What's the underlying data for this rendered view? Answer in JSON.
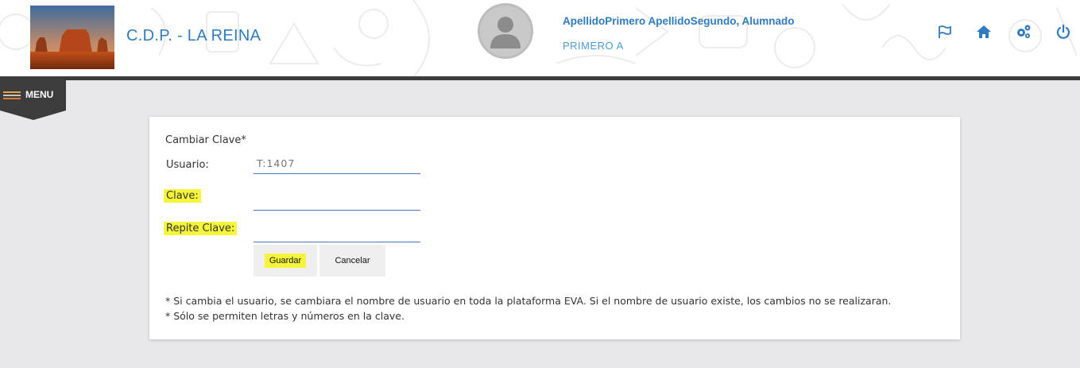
{
  "header": {
    "school_name": "C.D.P. - LA REINA",
    "user_name": "ApellidoPrimero ApellidoSegundo, Alumnado",
    "user_group": "PRIMERO A",
    "icons": [
      "flag-icon",
      "home-icon",
      "settings-icon",
      "power-icon"
    ]
  },
  "menu": {
    "label": "MENU"
  },
  "form": {
    "title": "Cambiar Clave*",
    "usuario_label": "Usuario:",
    "usuario_value": "T:1407",
    "clave_label": "Clave:",
    "repite_label": "Repite Clave:",
    "save_label": "Guardar",
    "cancel_label": "Cancelar",
    "notes": [
      "* Si cambia el usuario, se cambiara el nombre de usuario en toda la plataforma EVA. Si el nombre de usuario existe, los cambios no se realizaran.",
      "* Sólo se permiten letras y números en la clave."
    ]
  },
  "colors": {
    "accent": "#2f7bc0",
    "header_bar": "#3c3c3c",
    "highlight": "#f5f53a",
    "page_bg": "#e8e8ea"
  }
}
